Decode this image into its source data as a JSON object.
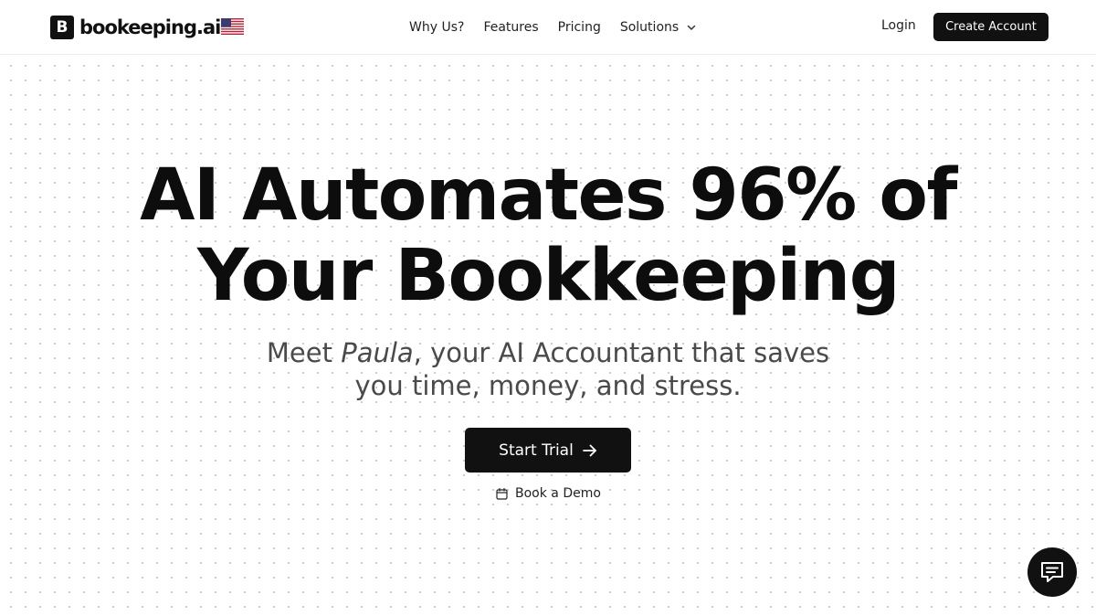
{
  "header": {
    "logo_mark": "B",
    "logo_text": "bookeeping.ai",
    "flag_icon": "us-flag-icon",
    "nav": [
      {
        "label": "Why Us?"
      },
      {
        "label": "Features"
      },
      {
        "label": "Pricing"
      },
      {
        "label": "Solutions",
        "has_dropdown": true
      }
    ],
    "login_label": "Login",
    "create_account_label": "Create Account"
  },
  "hero": {
    "title_line1": "AI Automates 96% of",
    "title_line2": "Your Bookkeeping",
    "subtitle_prefix": "Meet ",
    "subtitle_name": "Paula",
    "subtitle_line1_rest": ", your AI Accountant that saves",
    "subtitle_line2": "you time, money, and stress.",
    "start_trial_label": "Start Trial",
    "book_demo_label": "Book a Demo"
  },
  "colors": {
    "primary": "#111111",
    "background": "#ffffff",
    "subtitle_text": "#4a4a4a",
    "dot_pattern": "#c9c9c9"
  },
  "icons": {
    "start_trial": "arrow-right-icon",
    "book_demo": "calendar-icon",
    "solutions": "chevron-down-icon",
    "chat": "chat-icon"
  }
}
